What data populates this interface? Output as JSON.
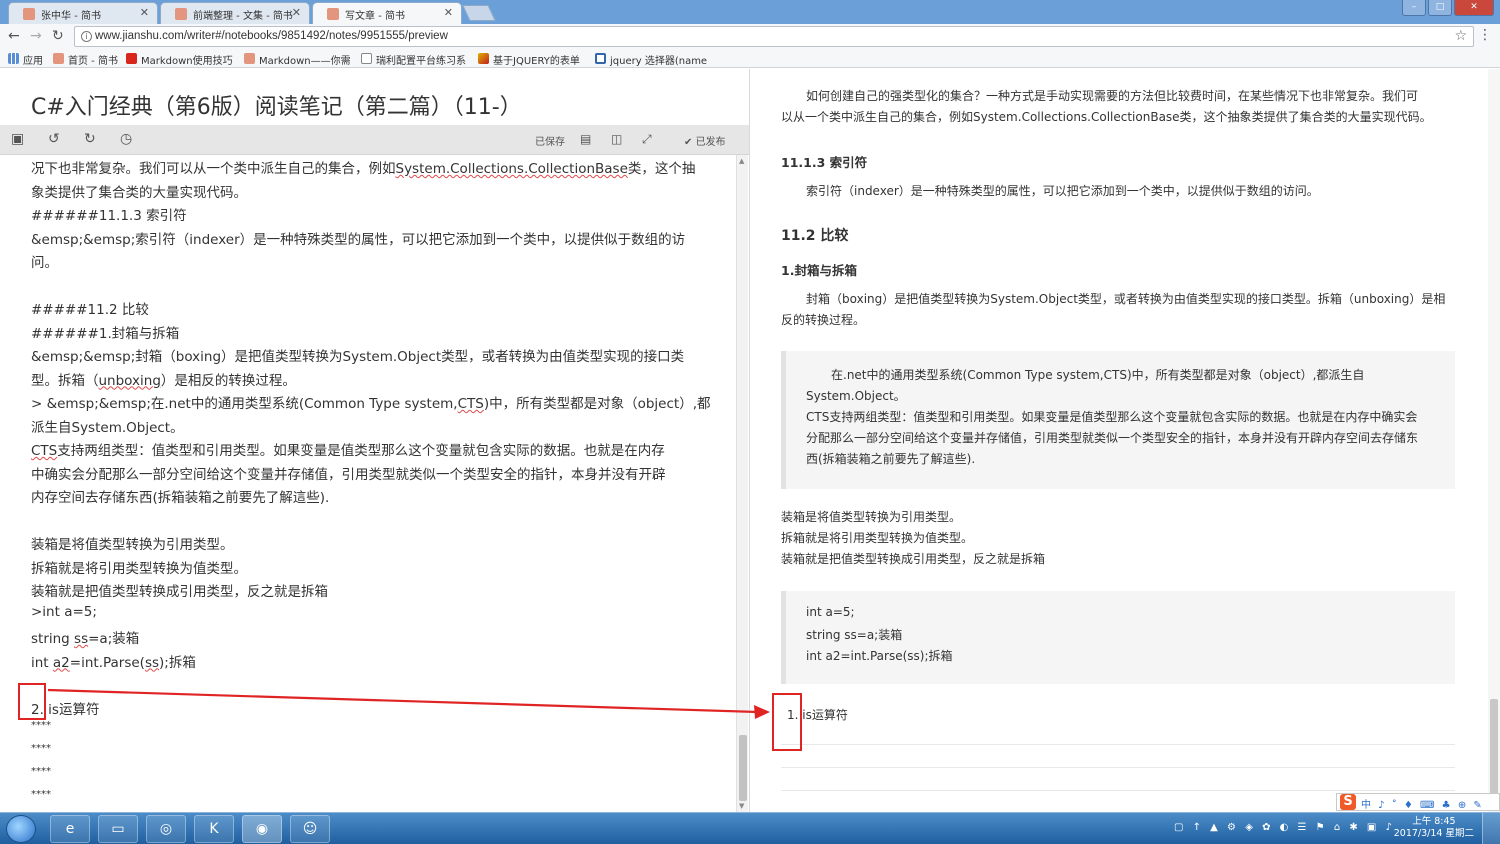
{
  "browser": {
    "tabs": [
      {
        "label": "张中华 - 简书"
      },
      {
        "label": "前端整理 - 文集 - 简书"
      },
      {
        "label": "写文章 - 简书"
      }
    ],
    "url": "www.jianshu.com/writer#/notebooks/9851492/notes/9951555/preview",
    "bookmarks": [
      {
        "label": "应用"
      },
      {
        "label": "首页 - 简书"
      },
      {
        "label": "Markdown使用技巧"
      },
      {
        "label": "Markdown——你需"
      },
      {
        "label": "瑞利配置平台练习系"
      },
      {
        "label": "基于JQUERY的表单"
      },
      {
        "label": "jquery 选择器(name"
      }
    ],
    "window_controls": {
      "minimize": "–",
      "maximize": "□",
      "close": "✕"
    }
  },
  "editor": {
    "title": "C#入门经典（第6版）阅读笔记（第二篇）（11-）",
    "toolbar": {
      "saved_label": "已保存",
      "publish_label": "已发布"
    },
    "lines": [
      {
        "parts": [
          {
            "t": "况下也非常复杂。我们可以从一个类中派生自己的集合，例如"
          },
          {
            "t": "System.Collections.CollectionBase",
            "w": true
          },
          {
            "t": "类，这个抽"
          }
        ]
      },
      {
        "parts": [
          {
            "t": "象类提供了集合类的大量实现代码。"
          }
        ]
      },
      {
        "parts": [
          {
            "t": "######11.1.3 索引符"
          }
        ]
      },
      {
        "parts": [
          {
            "t": "  &emsp;&emsp;索引符（indexer）是一种特殊类型的属性，可以把它添加到一个类中，以提供似于数组的访"
          }
        ]
      },
      {
        "parts": [
          {
            "t": "问。"
          }
        ]
      },
      {
        "parts": [
          {
            "t": ""
          }
        ]
      },
      {
        "parts": [
          {
            "t": "#####11.2 比较"
          }
        ]
      },
      {
        "parts": [
          {
            "t": "######1.封箱与拆箱"
          }
        ]
      },
      {
        "parts": [
          {
            "t": "  &emsp;&emsp;封箱（boxing）是把值类型转换为System.Object类型，或者转换为由值类型实现的接口类"
          }
        ]
      },
      {
        "parts": [
          {
            "t": "型。拆箱（"
          },
          {
            "t": "unboxing",
            "w": true
          },
          {
            "t": "）是相反的转换过程。"
          }
        ]
      },
      {
        "parts": [
          {
            "t": ">  &emsp;&emsp;在.net中的通用类型系统(Common Type system,"
          },
          {
            "t": "CTS",
            "w": true
          },
          {
            "t": ")中，所有类型都是对象（object）,都"
          }
        ]
      },
      {
        "parts": [
          {
            "t": "派生自System.Object。"
          }
        ]
      },
      {
        "parts": [
          {
            "t": "CTS",
            "w": true
          },
          {
            "t": "支持两组类型：值类型和引用类型。如果变量是值类型那么这个变量就包含实际的数据。也就是在内存"
          }
        ]
      },
      {
        "parts": [
          {
            "t": "中确实会分配那么一部分空间给这个变量并存储值，引用类型就类似一个类型安全的指针，本身并没有开辟"
          }
        ]
      },
      {
        "parts": [
          {
            "t": "内存空间去存储东西(拆箱装箱之前要先了解這些)."
          }
        ]
      },
      {
        "parts": [
          {
            "t": ""
          }
        ]
      },
      {
        "parts": [
          {
            "t": "装箱是将值类型转换为引用类型。"
          }
        ]
      },
      {
        "parts": [
          {
            "t": "拆箱就是将引用类型转换为值类型。"
          }
        ]
      },
      {
        "parts": [
          {
            "t": "装箱就是把值类型转换成引用类型，反之就是拆箱"
          }
        ]
      },
      {
        "parts": [
          {
            "t": ">int a=5;"
          }
        ]
      },
      {
        "parts": [
          {
            "t": "string "
          },
          {
            "t": "ss",
            "w": true
          },
          {
            "t": "=a;装箱"
          }
        ]
      },
      {
        "parts": [
          {
            "t": "int "
          },
          {
            "t": "a2",
            "w": true
          },
          {
            "t": "=int.Parse("
          },
          {
            "t": "ss",
            "w": true
          },
          {
            "t": ");拆箱"
          }
        ]
      },
      {
        "parts": [
          {
            "t": ""
          }
        ]
      },
      {
        "parts": [
          {
            "t": "2. is运算符"
          }
        ]
      }
    ],
    "stars": [
      "****",
      "****",
      "****",
      "****"
    ]
  },
  "preview": {
    "intro_line1": "如何创建自己的强类型化的集合？一种方式是手动实现需要的方法但比较费时间，在某些情况下也非常复杂。我们可",
    "intro_line2": "以从一个类中派生自己的集合，例如System.Collections.CollectionBase类，这个抽象类提供了集合类的大量实现代码。",
    "h_indexer": "11.1.3 索引符",
    "indexer_text": "索引符（indexer）是一种特殊类型的属性，可以把它添加到一个类中，以提供似于数组的访问。",
    "h_compare": "11.2 比较",
    "h_boxing": "1.封箱与拆箱",
    "boxing_line1": "封箱（boxing）是把值类型转换为System.Object类型，或者转换为由值类型实现的接口类型。拆箱（unboxing）是相",
    "boxing_line2": "反的转换过程。",
    "quote_lines": [
      "在.net中的通用类型系统(Common Type system,CTS)中，所有类型都是对象（object）,都派生自",
      "System.Object。",
      "CTS支持两组类型：值类型和引用类型。如果变量是值类型那么这个变量就包含实际的数据。也就是在内存中确实会",
      "分配那么一部分空间给这个变量并存储值，引用类型就类似一个类型安全的指针，本身并没有开辟内存空间去存储东",
      "西(拆箱装箱之前要先了解這些)."
    ],
    "plain_lines": [
      "装箱是将值类型转换为引用类型。",
      "拆箱就是将引用类型转换为值类型。",
      "装箱就是把值类型转换成引用类型，反之就是拆箱"
    ],
    "code_lines": [
      "int a=5;",
      "string ss=a;装箱",
      "int a2=int.Parse(ss);拆箱"
    ],
    "list_item": "1. is运算符"
  },
  "ime": {
    "logo": "S",
    "items": "中 ♪ ˚ ♦ ⌨ ♣ ⊕ ✎"
  },
  "taskbar": {
    "clock_time": "上午 8:45",
    "clock_date": "2017/3/14 星期二"
  },
  "colors": {
    "annotation": "#e02424",
    "taskbar": "#1f5fa0"
  }
}
